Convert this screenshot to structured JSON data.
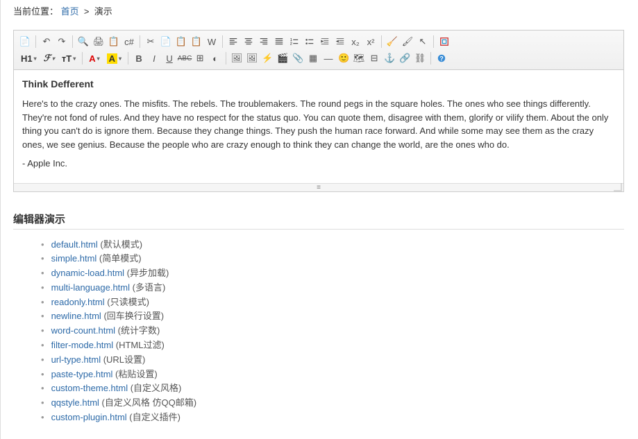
{
  "breadcrumb": {
    "label": "当前位置：",
    "home": "首页",
    "sep": ">",
    "current": "演示"
  },
  "editor": {
    "row1": [
      "source-icon",
      "sep",
      "undo-icon",
      "redo-icon",
      "sep",
      "preview-icon",
      "print-icon",
      "template-icon",
      "code-icon",
      "sep",
      "cut-icon",
      "copy-icon",
      "paste-icon",
      "paste-text-icon",
      "paste-word-icon",
      "sep",
      "align-left-icon",
      "align-center-icon",
      "align-right-icon",
      "align-justify-icon",
      "list-ol-icon",
      "list-ul-icon",
      "indent-icon",
      "outdent-icon",
      "subscript-icon",
      "superscript-icon",
      "sep",
      "remove-format-icon",
      "quickformat-icon",
      "select-all-icon",
      "sep",
      "fullscreen-icon"
    ],
    "row2_labels": {
      "h": "H1",
      "font": "ℱ",
      "size": "тT",
      "color": "A",
      "bg": "A"
    },
    "row2": [
      "bold-icon",
      "italic-icon",
      "underline-icon",
      "strike-icon",
      "row-col-icon",
      "eraser-icon",
      "sep",
      "image-icon",
      "multiimage-icon",
      "flash-icon",
      "media-icon",
      "attachment-icon",
      "table-icon",
      "hr-icon",
      "emoji-icon",
      "map-icon",
      "pagebreak-icon",
      "anchor-icon",
      "link-icon",
      "unlink-icon",
      "sep",
      "help-icon"
    ],
    "content": {
      "title": "Think Defferent",
      "p1": "Here's to the crazy ones. The misfits. The rebels. The troublemakers. The round pegs in the square holes. The ones who see things differently. They're not fond of rules. And they have no respect for the status quo. You can quote them, disagree with them, glorify or vilify them. About the only thing you can't do is ignore them. Because they change things. They push the human race forward. And while some may see them as the crazy ones, we see genius. Because the people who are crazy enough to think they can change the world, are the ones who do.",
      "p2": "- Apple Inc."
    }
  },
  "section_title": "编辑器演示",
  "demos": [
    {
      "link": "default.html",
      "desc": "(默认模式)"
    },
    {
      "link": "simple.html",
      "desc": "(简单模式)"
    },
    {
      "link": "dynamic-load.html",
      "desc": "(异步加载)"
    },
    {
      "link": "multi-language.html",
      "desc": "(多语言)"
    },
    {
      "link": "readonly.html",
      "desc": "(只读模式)"
    },
    {
      "link": "newline.html",
      "desc": "(回车换行设置)"
    },
    {
      "link": "word-count.html",
      "desc": "(统计字数)"
    },
    {
      "link": "filter-mode.html",
      "desc": "(HTML过滤)"
    },
    {
      "link": "url-type.html",
      "desc": "(URL设置)"
    },
    {
      "link": "paste-type.html",
      "desc": "(粘贴设置)"
    },
    {
      "link": "custom-theme.html",
      "desc": "(自定义风格)"
    },
    {
      "link": "qqstyle.html",
      "desc": "(自定义风格 仿QQ邮箱)"
    },
    {
      "link": "custom-plugin.html",
      "desc": "(自定义插件)"
    }
  ]
}
